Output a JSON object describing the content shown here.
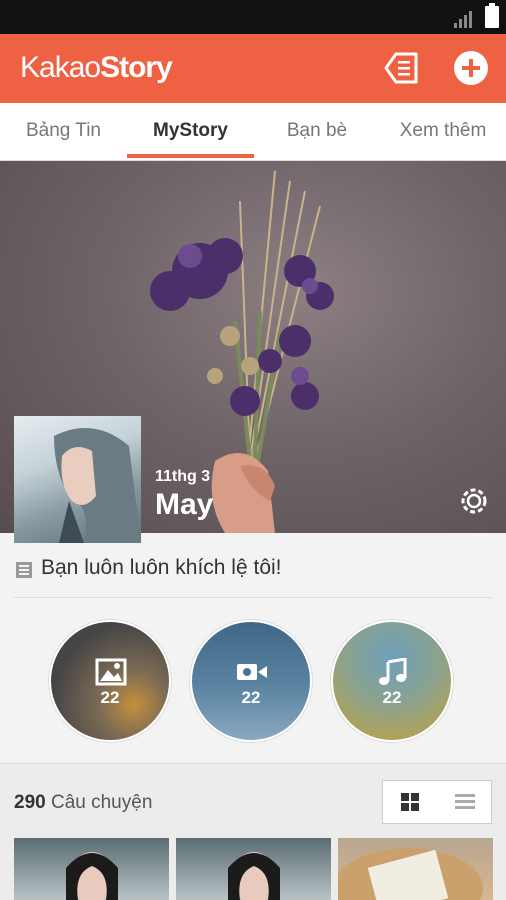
{
  "app": {
    "brand_light": "Kakao",
    "brand_bold": "Story"
  },
  "tabs": [
    {
      "label": "Bảng Tin"
    },
    {
      "label": "MyStory"
    },
    {
      "label": "Bạn bè"
    },
    {
      "label": "Xem thêm"
    }
  ],
  "profile": {
    "date": "11thg 3",
    "name": "May"
  },
  "status": {
    "text": "Bạn luôn luôn khích lệ tôi!"
  },
  "albums": [
    {
      "type": "photo-icon",
      "count": "22"
    },
    {
      "type": "video-icon",
      "count": "22"
    },
    {
      "type": "music-icon",
      "count": "22"
    }
  ],
  "stories": {
    "count": "290",
    "label": "Câu chuyện"
  },
  "colors": {
    "accent": "#ee6142"
  }
}
